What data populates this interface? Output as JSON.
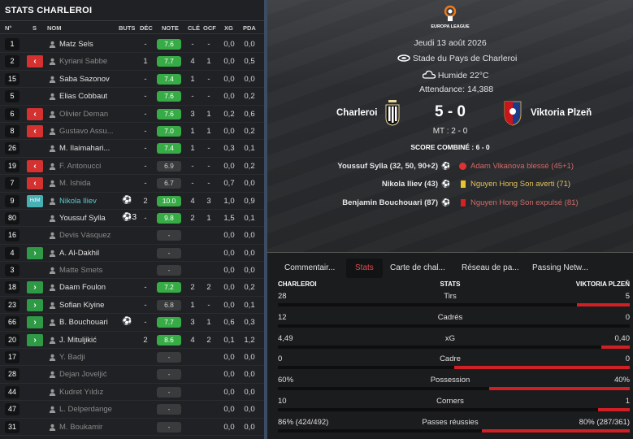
{
  "left": {
    "title": "STATS CHARLEROI",
    "columns": {
      "num": "N°",
      "s": "S",
      "nom": "NOM",
      "buts": "BUTS",
      "dec": "DÉC",
      "note": "NOTE",
      "cle": "CLÉ",
      "ocf": "OCF",
      "xg": "XG",
      "pda": "PDA"
    },
    "rows": [
      {
        "num": "1",
        "sub": "",
        "name": "Matz Sels",
        "dim": false,
        "hl": false,
        "ball": "",
        "buts": "",
        "dec": "-",
        "note": "7.6",
        "green": true,
        "cle": "-",
        "ocf": "-",
        "xg": "0,0",
        "pda": "0,0"
      },
      {
        "num": "2",
        "sub": "out",
        "name": "Kyriani Sabbe",
        "dim": true,
        "hl": false,
        "ball": "",
        "buts": "",
        "dec": "1",
        "note": "7.7",
        "green": true,
        "cle": "4",
        "ocf": "1",
        "xg": "0,0",
        "pda": "0,5"
      },
      {
        "num": "15",
        "sub": "",
        "name": "Saba Sazonov",
        "dim": false,
        "hl": false,
        "ball": "",
        "buts": "",
        "dec": "-",
        "note": "7.4",
        "green": true,
        "cle": "1",
        "ocf": "-",
        "xg": "0,0",
        "pda": "0,0"
      },
      {
        "num": "5",
        "sub": "",
        "name": "Elias Cobbaut",
        "dim": false,
        "hl": false,
        "ball": "",
        "buts": "",
        "dec": "-",
        "note": "7.6",
        "green": true,
        "cle": "-",
        "ocf": "-",
        "xg": "0,0",
        "pda": "0,2"
      },
      {
        "num": "6",
        "sub": "out",
        "name": "Olivier Deman",
        "dim": true,
        "hl": false,
        "ball": "",
        "buts": "",
        "dec": "-",
        "note": "7.6",
        "green": true,
        "cle": "3",
        "ocf": "1",
        "xg": "0,2",
        "pda": "0,6"
      },
      {
        "num": "8",
        "sub": "out",
        "name": "Gustavo Assu...",
        "dim": true,
        "hl": false,
        "ball": "",
        "buts": "",
        "dec": "-",
        "note": "7.0",
        "green": true,
        "cle": "1",
        "ocf": "1",
        "xg": "0,0",
        "pda": "0,2"
      },
      {
        "num": "26",
        "sub": "",
        "name": "M. Ilaimahari...",
        "dim": false,
        "hl": false,
        "ball": "",
        "buts": "",
        "dec": "-",
        "note": "7.4",
        "green": true,
        "cle": "1",
        "ocf": "-",
        "xg": "0,3",
        "pda": "0,1"
      },
      {
        "num": "19",
        "sub": "out",
        "name": "F. Antonucci",
        "dim": true,
        "hl": false,
        "ball": "",
        "buts": "",
        "dec": "-",
        "note": "6.9",
        "green": false,
        "cle": "-",
        "ocf": "-",
        "xg": "0,0",
        "pda": "0,2"
      },
      {
        "num": "7",
        "sub": "out",
        "name": "M. Ishida",
        "dim": true,
        "hl": false,
        "ball": "",
        "buts": "",
        "dec": "-",
        "note": "6.7",
        "green": false,
        "cle": "-",
        "ocf": "-",
        "xg": "0,7",
        "pda": "0,0"
      },
      {
        "num": "9",
        "sub": "hdm",
        "subtext": "HdM",
        "name": "Nikola Iliev",
        "dim": false,
        "hl": true,
        "ball": "⚽",
        "buts": "2",
        "dec": "",
        "note": "10.0",
        "green": true,
        "cle": "4",
        "ocf": "3",
        "xg": "1,0",
        "pda": "0,9"
      },
      {
        "num": "80",
        "sub": "",
        "name": "Youssuf Sylla",
        "dim": false,
        "hl": false,
        "ball": "⚽3",
        "buts": "",
        "dec": "-",
        "note": "9.8",
        "green": true,
        "cle": "2",
        "ocf": "1",
        "xg": "1,5",
        "pda": "0,1"
      },
      {
        "num": "16",
        "sub": "",
        "name": "Devis Vásquez",
        "dim": true,
        "hl": false,
        "ball": "",
        "buts": "",
        "dec": "",
        "note": "-",
        "green": false,
        "cle": "",
        "ocf": "",
        "xg": "0,0",
        "pda": "0,0"
      },
      {
        "num": "4",
        "sub": "in",
        "name": "A. Al-Dakhil",
        "dim": false,
        "hl": false,
        "ball": "",
        "buts": "",
        "dec": "",
        "note": "-",
        "green": false,
        "cle": "",
        "ocf": "",
        "xg": "0,0",
        "pda": "0,0"
      },
      {
        "num": "3",
        "sub": "",
        "name": "Matte Smets",
        "dim": true,
        "hl": false,
        "ball": "",
        "buts": "",
        "dec": "",
        "note": "-",
        "green": false,
        "cle": "",
        "ocf": "",
        "xg": "0,0",
        "pda": "0,0"
      },
      {
        "num": "18",
        "sub": "in",
        "name": "Daam Foulon",
        "dim": false,
        "hl": false,
        "ball": "",
        "buts": "",
        "dec": "-",
        "note": "7.2",
        "green": true,
        "cle": "2",
        "ocf": "2",
        "xg": "0,0",
        "pda": "0,2"
      },
      {
        "num": "23",
        "sub": "in",
        "name": "Sofian Kiyine",
        "dim": false,
        "hl": false,
        "ball": "",
        "buts": "",
        "dec": "-",
        "note": "6.8",
        "green": false,
        "cle": "1",
        "ocf": "-",
        "xg": "0,0",
        "pda": "0,1"
      },
      {
        "num": "66",
        "sub": "in",
        "name": "B. Bouchouari",
        "dim": false,
        "hl": false,
        "ball": "⚽",
        "buts": "",
        "dec": "-",
        "note": "7.7",
        "green": true,
        "cle": "3",
        "ocf": "1",
        "xg": "0,6",
        "pda": "0,3"
      },
      {
        "num": "20",
        "sub": "in",
        "name": "J. Mituljikić",
        "dim": false,
        "hl": false,
        "ball": "",
        "buts": "",
        "dec": "2",
        "note": "8.6",
        "green": true,
        "cle": "4",
        "ocf": "2",
        "xg": "0,1",
        "pda": "1,2"
      },
      {
        "num": "17",
        "sub": "",
        "name": "Y. Badji",
        "dim": true,
        "hl": false,
        "ball": "",
        "buts": "",
        "dec": "",
        "note": "-",
        "green": false,
        "cle": "",
        "ocf": "",
        "xg": "0,0",
        "pda": "0,0"
      },
      {
        "num": "28",
        "sub": "",
        "name": "Dejan Joveljić",
        "dim": true,
        "hl": false,
        "ball": "",
        "buts": "",
        "dec": "",
        "note": "-",
        "green": false,
        "cle": "",
        "ocf": "",
        "xg": "0,0",
        "pda": "0,0"
      },
      {
        "num": "44",
        "sub": "",
        "name": "Kudret Yıldız",
        "dim": true,
        "hl": false,
        "ball": "",
        "buts": "",
        "dec": "",
        "note": "-",
        "green": false,
        "cle": "",
        "ocf": "",
        "xg": "0,0",
        "pda": "0,0"
      },
      {
        "num": "47",
        "sub": "",
        "name": "L. Delperdange",
        "dim": true,
        "hl": false,
        "ball": "",
        "buts": "",
        "dec": "",
        "note": "-",
        "green": false,
        "cle": "",
        "ocf": "",
        "xg": "0,0",
        "pda": "0,0"
      },
      {
        "num": "31",
        "sub": "",
        "name": "M. Boukamir",
        "dim": true,
        "hl": false,
        "ball": "",
        "buts": "",
        "dec": "",
        "note": "-",
        "green": false,
        "cle": "",
        "ocf": "",
        "xg": "0,0",
        "pda": "0,0"
      }
    ]
  },
  "match": {
    "competition": "EUROPA LEAGUE",
    "date": "Jeudi 13 août 2026",
    "stadium": "Stade du Pays de Charleroi",
    "weather": "Humide 22°C",
    "attendance": "Attendance: 14,388",
    "home": "Charleroi",
    "away": "Viktoria Plzeň",
    "score": "5 - 0",
    "halftime": "MT : 2 - 0",
    "combined": "SCORE COMBINÉ : 6 - 0",
    "home_events": [
      "Youssuf Sylla (32, 50, 90+2)",
      "Nikola Iliev (43)",
      "Benjamin Bouchouari (87)"
    ],
    "away_events": [
      {
        "text": "Adam Vlkanova blessé (45+1)",
        "kind": "injury"
      },
      {
        "text": "Nguyen Hong Son averti (71)",
        "kind": "yellow"
      },
      {
        "text": "Nguyen Hong Son expulsé (81)",
        "kind": "red"
      }
    ],
    "colors": {
      "accent": "#e44b4b",
      "good": "#37ab45",
      "bar": "#d01f25"
    }
  },
  "tabs": [
    "Commentair...",
    "Stats",
    "Carte de chal...",
    "Réseau de pa...",
    "Passing Netw..."
  ],
  "stats": {
    "home_label": "CHARLEROI",
    "mid_label": "STATS",
    "away_label": "VIKTORIA PLZEŇ",
    "rows": [
      {
        "home": "28",
        "label": "Tirs",
        "away": "5",
        "share": 0.85
      },
      {
        "home": "12",
        "label": "Cadrés",
        "away": "0",
        "share": 1.0
      },
      {
        "home": "4,49",
        "label": "xG",
        "away": "0,40",
        "share": 0.92
      },
      {
        "home": "0",
        "label": "Cadre",
        "away": "0",
        "share": 0.5
      },
      {
        "home": "60%",
        "label": "Possession",
        "away": "40%",
        "share": 0.6
      },
      {
        "home": "10",
        "label": "Corners",
        "away": "1",
        "share": 0.91
      },
      {
        "home": "86% (424/492)",
        "label": "Passes réussies",
        "away": "80% (287/361)",
        "share": 0.58
      }
    ]
  }
}
